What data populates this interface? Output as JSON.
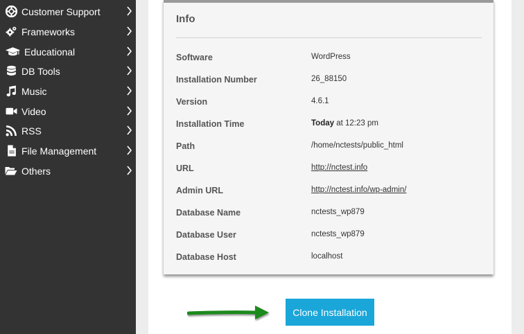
{
  "sidebar": {
    "items": [
      {
        "label": "Customer Support",
        "icon": "life-ring-icon"
      },
      {
        "label": "Frameworks",
        "icon": "gears-icon"
      },
      {
        "label": "Educational",
        "icon": "graduation-cap-icon"
      },
      {
        "label": "DB Tools",
        "icon": "database-icon"
      },
      {
        "label": "Music",
        "icon": "music-note-icon"
      },
      {
        "label": "Video",
        "icon": "video-camera-icon"
      },
      {
        "label": "RSS",
        "icon": "rss-icon"
      },
      {
        "label": "File Management",
        "icon": "file-icon"
      },
      {
        "label": "Others",
        "icon": "folder-open-icon"
      }
    ]
  },
  "info": {
    "title": "Info",
    "rows": [
      {
        "label": "Software",
        "value": "WordPress"
      },
      {
        "label": "Installation Number",
        "value": "26_88150"
      },
      {
        "label": "Version",
        "value": "4.6.1"
      },
      {
        "label": "Installation Time",
        "value_bold": "Today",
        "value": " at 12:23 pm"
      },
      {
        "label": "Path",
        "value": "/home/nctests/public_html"
      },
      {
        "label": "URL",
        "value": "http://nctest.info"
      },
      {
        "label": "Admin URL",
        "value": "http://nctest.info/wp-admin/"
      },
      {
        "label": "Database Name",
        "value": "nctests_wp879"
      },
      {
        "label": "Database User",
        "value": "nctests_wp879"
      },
      {
        "label": "Database Host",
        "value": "localhost"
      }
    ]
  },
  "actions": {
    "clone_label": "Clone Installation"
  },
  "colors": {
    "sidebar_bg": "#333333",
    "button_bg": "#1aa6d9",
    "arrow": "#1f8a1f"
  }
}
